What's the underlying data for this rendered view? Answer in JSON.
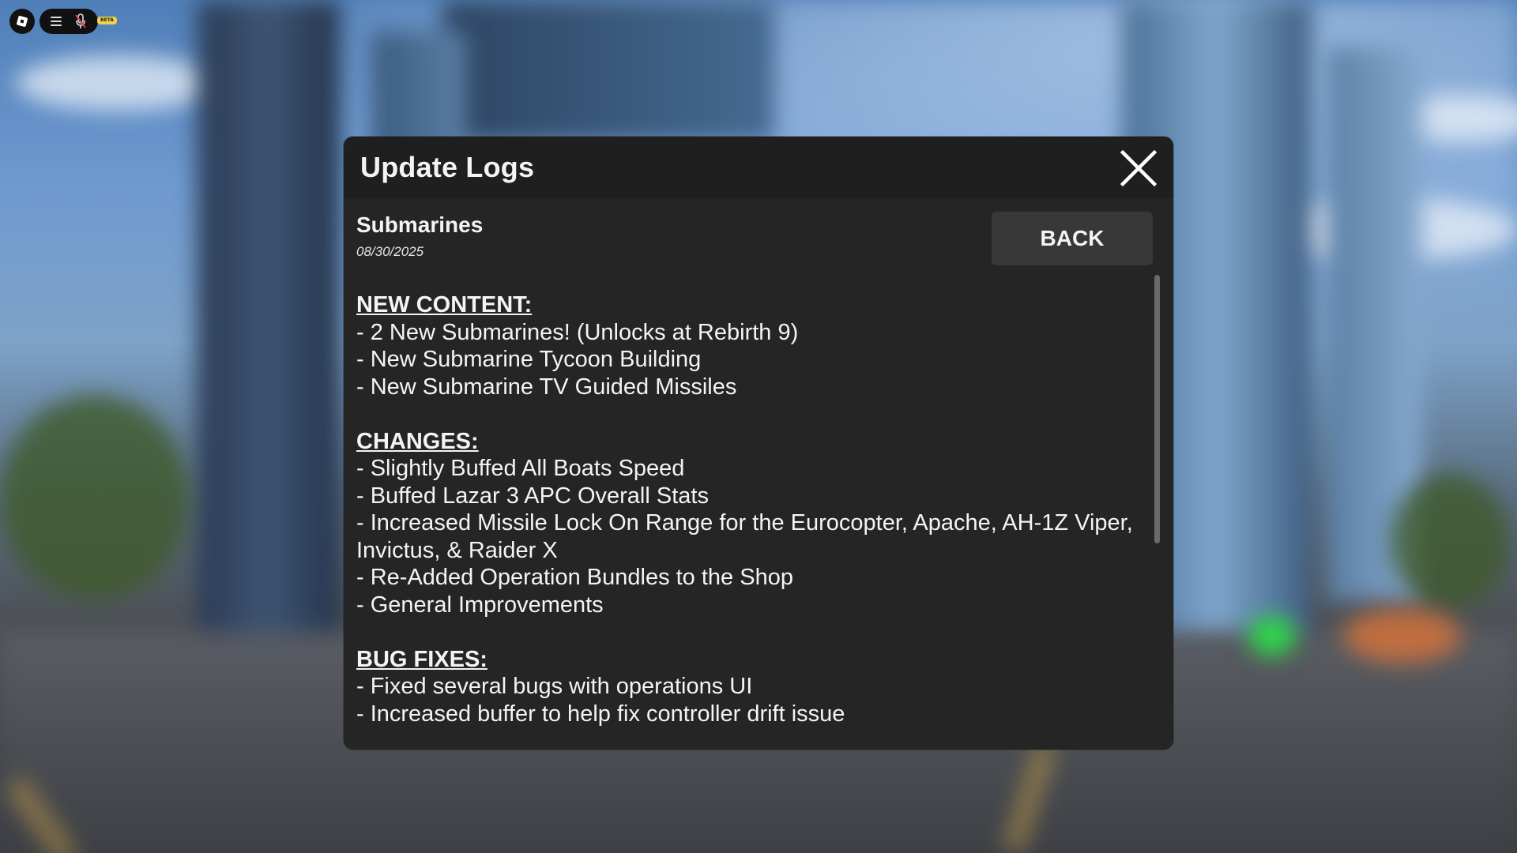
{
  "dialog": {
    "title": "Update Logs",
    "close_icon": "close-icon",
    "back_label": "BACK"
  },
  "entry": {
    "title": "Submarines",
    "date": "08/30/2025"
  },
  "log": {
    "new_content": {
      "heading": "NEW CONTENT:",
      "items": [
        "- 2 New Submarines! (Unlocks at Rebirth 9)",
        "- New Submarine Tycoon Building",
        "- New Submarine TV Guided Missiles"
      ]
    },
    "changes": {
      "heading": "CHANGES:",
      "items": [
        "- Slightly Buffed All Boats Speed",
        "- Buffed Lazar 3 APC Overall Stats",
        "- Increased Missile Lock On Range for the Eurocopter, Apache, AH-1Z Viper, Invictus, & Raider X",
        "- Re-Added Operation Bundles to the Shop",
        "- General Improvements"
      ]
    },
    "bug_fixes": {
      "heading": "BUG FIXES:",
      "items": [
        "- Fixed several bugs with operations UI",
        "- Increased buffer to help fix controller drift issue"
      ]
    }
  },
  "topbar": {
    "logo_icon": "roblox-logo-icon",
    "menu_icon": "menu-icon",
    "mic_icon": "microphone-muted-icon",
    "badge": "BETA"
  },
  "colors": {
    "panel": "#252525",
    "header": "#1f1f1f",
    "button": "#383838",
    "text": "#f4f4f4",
    "scrollbar": "#6a6a6a"
  }
}
